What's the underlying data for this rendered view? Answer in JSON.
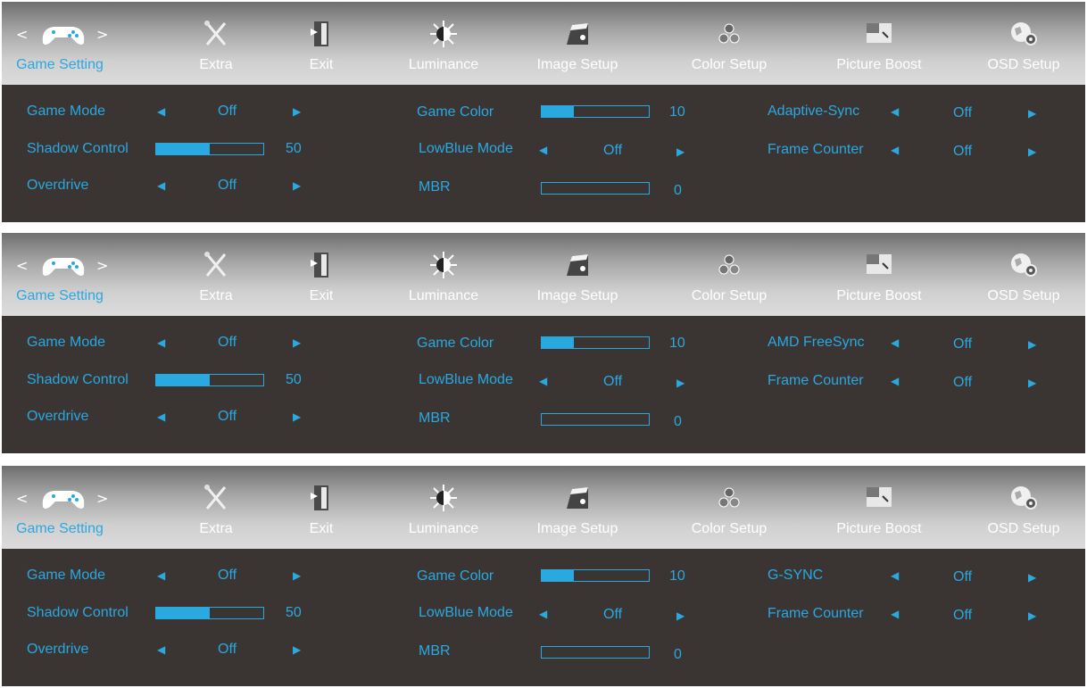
{
  "tabs": [
    {
      "label": "Game Setting",
      "icon": "gamepad-icon",
      "active": true
    },
    {
      "label": "Extra",
      "icon": "tools-icon"
    },
    {
      "label": "Exit",
      "icon": "exit-door-icon"
    },
    {
      "label": "Luminance",
      "icon": "sun-icon"
    },
    {
      "label": "Image Setup",
      "icon": "image-icon"
    },
    {
      "label": "Color Setup",
      "icon": "color-circles-icon"
    },
    {
      "label": "Picture Boost",
      "icon": "picture-boost-icon"
    },
    {
      "label": "OSD Setup",
      "icon": "globe-gear-icon"
    }
  ],
  "panels": [
    {
      "game_mode": {
        "label": "Game Mode",
        "value": "Off"
      },
      "shadow_control": {
        "label": "Shadow Control",
        "value": "50",
        "level": 0.5
      },
      "overdrive": {
        "label": "Overdrive",
        "value": "Off"
      },
      "game_color": {
        "label": "Game Color",
        "value": "10",
        "level": 0.3
      },
      "lowblue_mode": {
        "label": "LowBlue Mode",
        "value": "Off"
      },
      "mbr": {
        "label": "MBR",
        "value": "0",
        "level": 0
      },
      "sync": {
        "label": "Adaptive-Sync",
        "value": "Off"
      },
      "frame_counter": {
        "label": "Frame Counter",
        "value": "Off"
      }
    },
    {
      "game_mode": {
        "label": "Game Mode",
        "value": "Off"
      },
      "shadow_control": {
        "label": "Shadow Control",
        "value": "50",
        "level": 0.5
      },
      "overdrive": {
        "label": "Overdrive",
        "value": "Off"
      },
      "game_color": {
        "label": "Game Color",
        "value": "10",
        "level": 0.3
      },
      "lowblue_mode": {
        "label": "LowBlue Mode",
        "value": "Off"
      },
      "mbr": {
        "label": "MBR",
        "value": "0",
        "level": 0
      },
      "sync": {
        "label": "AMD FreeSync",
        "value": "Off"
      },
      "frame_counter": {
        "label": "Frame Counter",
        "value": "Off"
      }
    },
    {
      "game_mode": {
        "label": "Game Mode",
        "value": "Off"
      },
      "shadow_control": {
        "label": "Shadow Control",
        "value": "50",
        "level": 0.5
      },
      "overdrive": {
        "label": "Overdrive",
        "value": "Off"
      },
      "game_color": {
        "label": "Game Color",
        "value": "10",
        "level": 0.3
      },
      "lowblue_mode": {
        "label": "LowBlue Mode",
        "value": "Off"
      },
      "mbr": {
        "label": "MBR",
        "value": "0",
        "level": 0
      },
      "sync": {
        "label": "G-SYNC",
        "value": "Off"
      },
      "frame_counter": {
        "label": "Frame Counter",
        "value": "Off"
      }
    }
  ],
  "colors": {
    "accent": "#2aa8e0",
    "panel_bg": "#3a3533",
    "tab_text": "#ffffff"
  }
}
